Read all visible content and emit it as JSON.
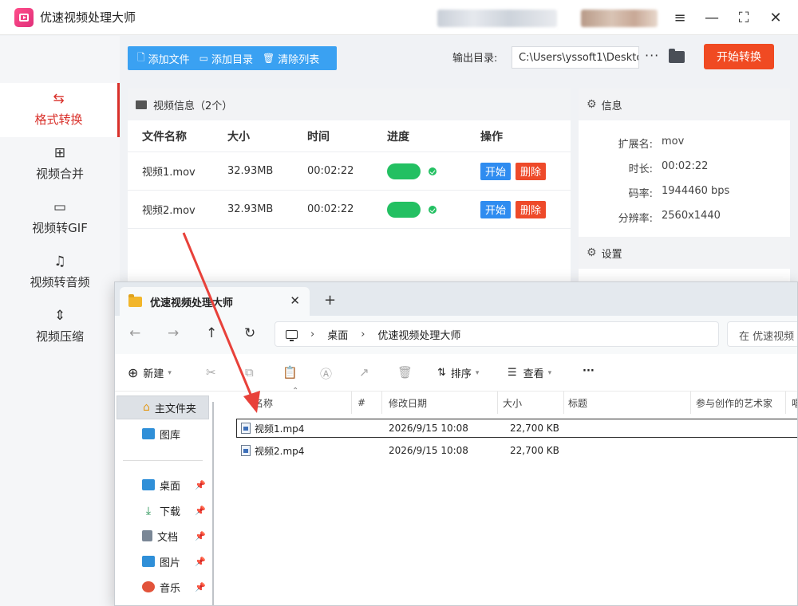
{
  "app": {
    "title": "优速视频处理大师",
    "sidebar": [
      {
        "label": "格式转换",
        "icon": "format-convert-icon",
        "active": true
      },
      {
        "label": "视频合并",
        "icon": "merge-icon"
      },
      {
        "label": "视频转GIF",
        "icon": "gif-icon"
      },
      {
        "label": "视频转音频",
        "icon": "audio-icon"
      },
      {
        "label": "视频压缩",
        "icon": "compress-icon"
      }
    ],
    "toolbar": {
      "add_file": "添加文件",
      "add_dir": "添加目录",
      "clear_list": "清除列表"
    },
    "output": {
      "label": "输出目录:",
      "path": "C:\\Users\\yssoft1\\Deskto",
      "more": "···"
    },
    "start_button": "开始转换",
    "video_panel": {
      "title": "视频信息（2个）",
      "columns": [
        "文件名称",
        "大小",
        "时间",
        "进度",
        "操作"
      ],
      "rows": [
        {
          "name": "视频1.mov",
          "size": "32.93MB",
          "time": "00:02:22",
          "progress": 1.0
        },
        {
          "name": "视频2.mov",
          "size": "32.93MB",
          "time": "00:02:22",
          "progress": 1.0
        }
      ],
      "start_label": "开始",
      "delete_label": "删除"
    },
    "info_panel": {
      "title": "信息",
      "fields": [
        {
          "key": "扩展名:",
          "value": "mov"
        },
        {
          "key": "时长:",
          "value": "00:02:22"
        },
        {
          "key": "码率:",
          "value": "1944460 bps"
        },
        {
          "key": "分辨率:",
          "value": "2560x1440"
        }
      ],
      "settings_title": "设置"
    }
  },
  "explorer": {
    "tab_title": "优速视频处理大师",
    "breadcrumb": [
      "桌面",
      "优速视频处理大师"
    ],
    "search_placeholder": "在 优速视频",
    "commands": {
      "new": "新建",
      "sort": "排序",
      "view": "查看",
      "more": "···"
    },
    "nav": {
      "home": "主文件夹",
      "gallery": "图库",
      "quick": [
        {
          "label": "桌面",
          "icon": "desktop-icon",
          "color": "#2f8fd8"
        },
        {
          "label": "下载",
          "icon": "download-icon",
          "color": "#1e8f4e"
        },
        {
          "label": "文档",
          "icon": "document-icon",
          "color": "#7a8796"
        },
        {
          "label": "图片",
          "icon": "pictures-icon",
          "color": "#2f8fd8"
        },
        {
          "label": "音乐",
          "icon": "music-icon",
          "color": "#e2533a"
        }
      ]
    },
    "columns": [
      "名称",
      "#",
      "修改日期",
      "大小",
      "标题",
      "参与创作的艺术家",
      "唱"
    ],
    "files": [
      {
        "name": "视频1.mp4",
        "date": "2026/9/15 10:08",
        "size": "22,700 KB",
        "selected": true
      },
      {
        "name": "视频2.mp4",
        "date": "2026/9/15 10:08",
        "size": "22,700 KB",
        "selected": false
      }
    ]
  },
  "annotation": {
    "arrow_color": "#e8413a"
  }
}
